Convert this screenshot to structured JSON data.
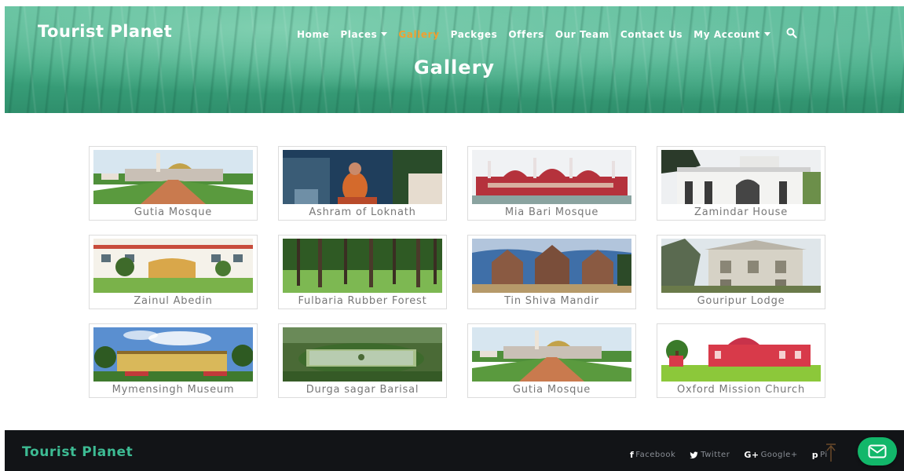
{
  "header": {
    "brand": "Tourist Planet",
    "title": "Gallery",
    "nav": [
      {
        "label": "Home",
        "active": false,
        "dropdown": false
      },
      {
        "label": "Places",
        "active": false,
        "dropdown": true
      },
      {
        "label": "Gallery",
        "active": true,
        "dropdown": false
      },
      {
        "label": "Packges",
        "active": false,
        "dropdown": false
      },
      {
        "label": "Offers",
        "active": false,
        "dropdown": false
      },
      {
        "label": "Our Team",
        "active": false,
        "dropdown": false
      },
      {
        "label": "Contact Us",
        "active": false,
        "dropdown": false
      },
      {
        "label": "My Account",
        "active": false,
        "dropdown": true
      }
    ],
    "search_icon": "search-icon",
    "active_color": "#f0a030"
  },
  "gallery": {
    "items": [
      {
        "caption": "Gutia Mosque",
        "scene": "mosque-garden"
      },
      {
        "caption": "Ashram of Loknath",
        "scene": "ashram"
      },
      {
        "caption": "Mia Bari Mosque",
        "scene": "red-mosque"
      },
      {
        "caption": "Zamindar House",
        "scene": "white-palace"
      },
      {
        "caption": "Zainul Abedin",
        "scene": "museum-building"
      },
      {
        "caption": "Fulbaria Rubber Forest",
        "scene": "forest"
      },
      {
        "caption": "Tin Shiva Mandir",
        "scene": "temple"
      },
      {
        "caption": "Gouripur Lodge",
        "scene": "old-lodge"
      },
      {
        "caption": "Mymensingh Museum",
        "scene": "museum-garden"
      },
      {
        "caption": "Durga sagar Barisal",
        "scene": "lake"
      },
      {
        "caption": "Gutia Mosque",
        "scene": "mosque-garden"
      },
      {
        "caption": "Oxford Mission Church",
        "scene": "red-church"
      }
    ]
  },
  "footer": {
    "brand": "Tourist Planet",
    "social": [
      {
        "label": "Facebook",
        "icon": "facebook-icon"
      },
      {
        "label": "Twitter",
        "icon": "twitter-icon"
      },
      {
        "label": "Google+",
        "icon": "google-plus-icon"
      },
      {
        "label": "Pi",
        "icon": "pinterest-icon"
      }
    ],
    "brand_color": "#3dbb93",
    "chat_button_color": "#12b76a"
  }
}
